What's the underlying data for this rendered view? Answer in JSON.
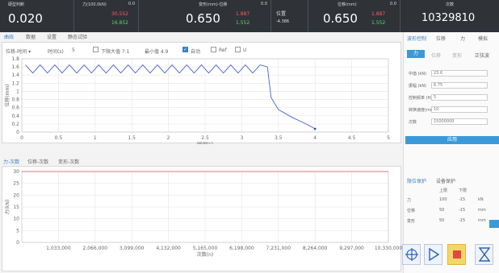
{
  "topbar": {
    "panel1": {
      "header": "硬型判断",
      "value": "0.020"
    },
    "panel2": {
      "header": "力(100.0kN)",
      "header_value": "0.0",
      "red": "30.552",
      "green": "16.852"
    },
    "panel3": {
      "header": "变形(mm)-位移",
      "header_value": "0.0",
      "value": "0.650",
      "red": "1.887",
      "green": "1.552",
      "label": "位置",
      "label_val": "-4.386"
    },
    "panel4": {
      "header": "位移(mm)",
      "header_value": "0.0",
      "value": "0.650",
      "red": "1.887",
      "green": "1.552"
    },
    "panel5": {
      "header": "次数",
      "value": "10329810"
    }
  },
  "upper": {
    "tabs": [
      "曲线",
      "数据",
      "设置",
      "静态试验"
    ],
    "controls": {
      "dropdown": "位移-时间",
      "time_label": "时间(s)",
      "time_value": "5",
      "max_label": "下限大值 7.1",
      "min_label": "最小值 4.9",
      "auto_label": "自动",
      "ref_label": "Ref",
      "u_label": "U"
    }
  },
  "chart1": {
    "ylabel": "位移(mm)",
    "xlabel": "时间(s)",
    "yticks": [
      "1.8",
      "1.6",
      "1.4",
      "1.2",
      "1",
      "0.8",
      "0.6",
      "0.4",
      "0.2",
      "0"
    ],
    "xticks": [
      "0",
      "0.5",
      "1",
      "1.5",
      "2",
      "2.5",
      "3",
      "3.5",
      "4",
      "4.5",
      "5"
    ]
  },
  "lower": {
    "tabs": [
      "力-次数",
      "位移-次数",
      "变形-次数"
    ]
  },
  "chart2": {
    "ylabel": "力(kN)",
    "xlabel": "次数(n)",
    "yticks": [
      "30",
      "25",
      "20",
      "15",
      "10",
      "5",
      "0"
    ],
    "xticks": [
      "1,033,000",
      "2,066,000",
      "3,099,000",
      "4,132,000",
      "5,165,000",
      "6,198,000",
      "7,231,000",
      "8,264,000",
      "9,297,000",
      "10,330,000"
    ]
  },
  "chart_data": [
    {
      "type": "line",
      "xlabel": "时间(s)",
      "ylabel": "位移(mm)",
      "xlim": [
        0,
        5
      ],
      "ylim": [
        0,
        1.8
      ],
      "series": [
        {
          "x": [
            0.05,
            0.15,
            0.25,
            0.35,
            0.45,
            0.55,
            0.65,
            0.75,
            0.85,
            0.95,
            1.05,
            1.15,
            1.25,
            1.35,
            1.45,
            1.55,
            1.65,
            1.75,
            1.85,
            1.95,
            2.05,
            2.15,
            2.25,
            2.35,
            2.45,
            2.55,
            2.65,
            2.75,
            2.85,
            2.95,
            3.05,
            3.15,
            3.25,
            3.35,
            3.4,
            3.5,
            3.7,
            3.9,
            4.0
          ],
          "y": [
            1.65,
            1.45,
            1.65,
            1.45,
            1.65,
            1.45,
            1.65,
            1.45,
            1.65,
            1.45,
            1.65,
            1.45,
            1.65,
            1.45,
            1.65,
            1.45,
            1.65,
            1.45,
            1.65,
            1.45,
            1.65,
            1.45,
            1.65,
            1.45,
            1.65,
            1.45,
            1.65,
            1.45,
            1.65,
            1.45,
            1.65,
            1.45,
            1.65,
            1.6,
            0.85,
            0.55,
            0.35,
            0.18,
            0.08
          ]
        }
      ]
    },
    {
      "type": "line",
      "xlabel": "次数(n)",
      "ylabel": "力(kN)",
      "xlim": [
        0,
        10330000
      ],
      "ylim": [
        0,
        30
      ],
      "series": [
        {
          "x": [
            0,
            10330000
          ],
          "y": [
            30,
            30
          ]
        }
      ]
    }
  ],
  "right": {
    "tabs": [
      "波形控制",
      "位移",
      "力",
      "模拟"
    ],
    "subtabs": [
      "力",
      "位移",
      "变形",
      "正弦波"
    ],
    "rows": [
      {
        "label": "中值 (kN)",
        "value": "23.6"
      },
      {
        "label": "振幅 (kN)",
        "value": "6.75"
      },
      {
        "label": "控制频率 (Hz)",
        "value": "5"
      },
      {
        "label": "转换速度(mm/min)",
        "value": "10"
      },
      {
        "label": "次数",
        "value": "15000000"
      }
    ],
    "apply": "应用",
    "protect_tabs": [
      "限位保护",
      "设备保护"
    ],
    "protect_head": [
      "上限",
      "下限"
    ],
    "protect_rows": [
      {
        "label": "力",
        "upper": "100",
        "lower": "-15",
        "unit": "kN"
      },
      {
        "label": "位移",
        "upper": "50",
        "lower": "-15",
        "unit": "mm"
      },
      {
        "label": "变形",
        "upper": "50",
        "lower": "-15",
        "unit": "mm"
      }
    ]
  }
}
